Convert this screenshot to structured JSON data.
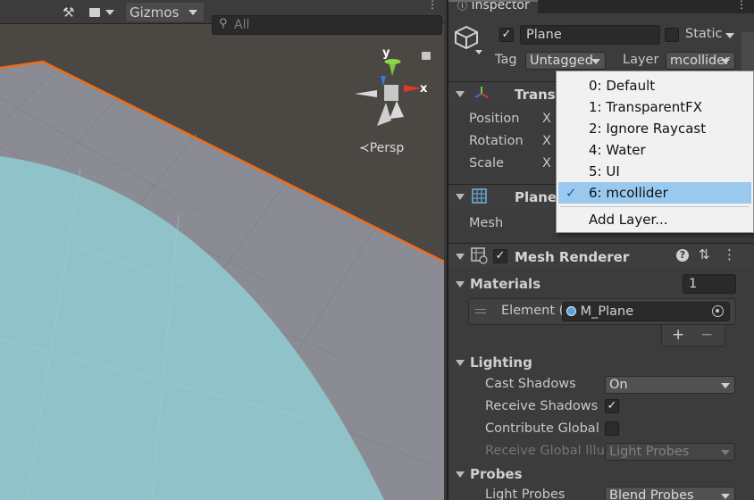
{
  "scene": {
    "toolbar": {
      "gizmos_label": "Gizmos",
      "search_placeholder": "All"
    },
    "gizmo_axes": {
      "y": "y",
      "x": "x"
    },
    "projection_label": "Persp"
  },
  "inspector": {
    "tab_title": "Inspector",
    "object": {
      "name": "Plane",
      "active": true,
      "static_label": "Static",
      "tag_label": "Tag",
      "tag_value": "Untagged",
      "layer_label": "Layer",
      "layer_value": "mcollider"
    },
    "transform": {
      "title": "Transf",
      "rows": [
        {
          "label": "Position",
          "axis": "X"
        },
        {
          "label": "Rotation",
          "axis": "X"
        },
        {
          "label": "Scale",
          "axis": "X"
        }
      ]
    },
    "mesh_filter": {
      "title": "Plane",
      "mesh_label": "Mesh"
    },
    "mesh_renderer": {
      "title": "Mesh Renderer",
      "enabled": true,
      "materials_label": "Materials",
      "materials_count": "1",
      "element_label": "Element (",
      "element_value": "M_Plane",
      "add_label": "+",
      "remove_label": "−",
      "lighting_label": "Lighting",
      "cast_shadows_label": "Cast Shadows",
      "cast_shadows_value": "On",
      "receive_shadows_label": "Receive Shadows",
      "receive_shadows": true,
      "contribute_gi_label": "Contribute Global",
      "receive_gi_label": "Receive Global Illu",
      "receive_gi_value": "Light Probes",
      "probes_label": "Probes",
      "light_probes_label": "Light Probes",
      "light_probes_value": "Blend Probes"
    }
  },
  "layer_menu": {
    "items": [
      {
        "label": "0: Default",
        "selected": false
      },
      {
        "label": "1: TransparentFX",
        "selected": false
      },
      {
        "label": "2: Ignore Raycast",
        "selected": false
      },
      {
        "label": "4: Water",
        "selected": false
      },
      {
        "label": "5: UI",
        "selected": false
      },
      {
        "label": "6: mcollider",
        "selected": true
      }
    ],
    "add_layer_label": "Add Layer...",
    "check_glyph": "✓"
  },
  "colors": {
    "selection_outline": "#f26a1b",
    "menu_highlight": "#99c9ef",
    "sphere_fill": "#8fc3c9"
  }
}
